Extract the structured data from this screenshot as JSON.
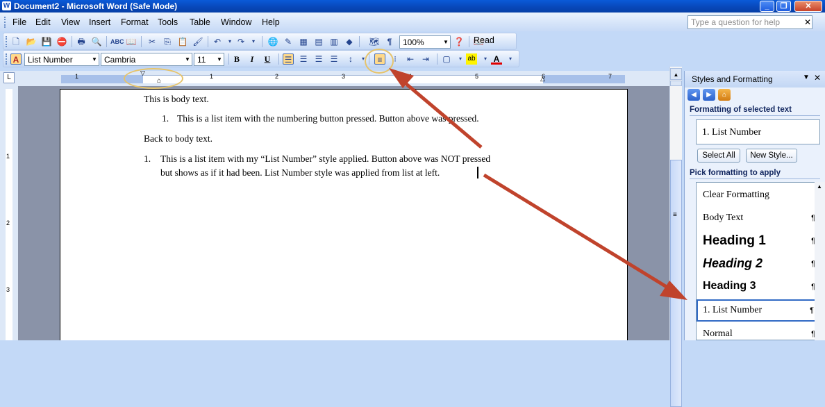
{
  "window": {
    "title": "Document2 - Microsoft Word (Safe Mode)"
  },
  "menubar": {
    "items": [
      "File",
      "Edit",
      "View",
      "Insert",
      "Format",
      "Tools",
      "Table",
      "Window",
      "Help"
    ],
    "help_placeholder": "Type a question for help"
  },
  "standard_toolbar": {
    "zoom": "100%",
    "read_label": "Read"
  },
  "formatting_toolbar": {
    "style": "List Number",
    "font": "Cambria",
    "size": "11",
    "bold": "B",
    "italic": "I",
    "underline": "U"
  },
  "ruler": {
    "numbers": [
      "1",
      "1",
      "2",
      "3",
      "4",
      "5",
      "6",
      "7"
    ],
    "vertical_numbers": [
      "1",
      "2",
      "3"
    ]
  },
  "document": {
    "lines": [
      "This is body text.",
      "1.",
      "This is a list item with the numbering button pressed. Button above was pressed.",
      "Back to body text.",
      "1.",
      "This is a list item with my “List Number” style applied. Button above was NOT pressed",
      "but shows as if it had been. List Number style was applied from list at left."
    ]
  },
  "task_pane": {
    "title": "Styles and Formatting",
    "formatting_selected_label": "Formatting of selected text",
    "selected_style": "1.  List Number",
    "select_all": "Select All",
    "new_style": "New Style...",
    "pick_label": "Pick formatting to apply",
    "styles": [
      {
        "name": "Clear Formatting",
        "mark": ""
      },
      {
        "name": "Body Text",
        "mark": "¶"
      },
      {
        "name": "Heading 1",
        "mark": "¶"
      },
      {
        "name": "Heading 2",
        "mark": "¶"
      },
      {
        "name": "Heading 3",
        "mark": "¶"
      },
      {
        "name": "1.  List Number",
        "mark": "¶"
      },
      {
        "name": "Normal",
        "mark": "¶"
      }
    ]
  },
  "colors": {
    "arrow": "#c0432c",
    "annotation_circle": "#e6c36a",
    "pressed_button": "#ffd98a"
  }
}
